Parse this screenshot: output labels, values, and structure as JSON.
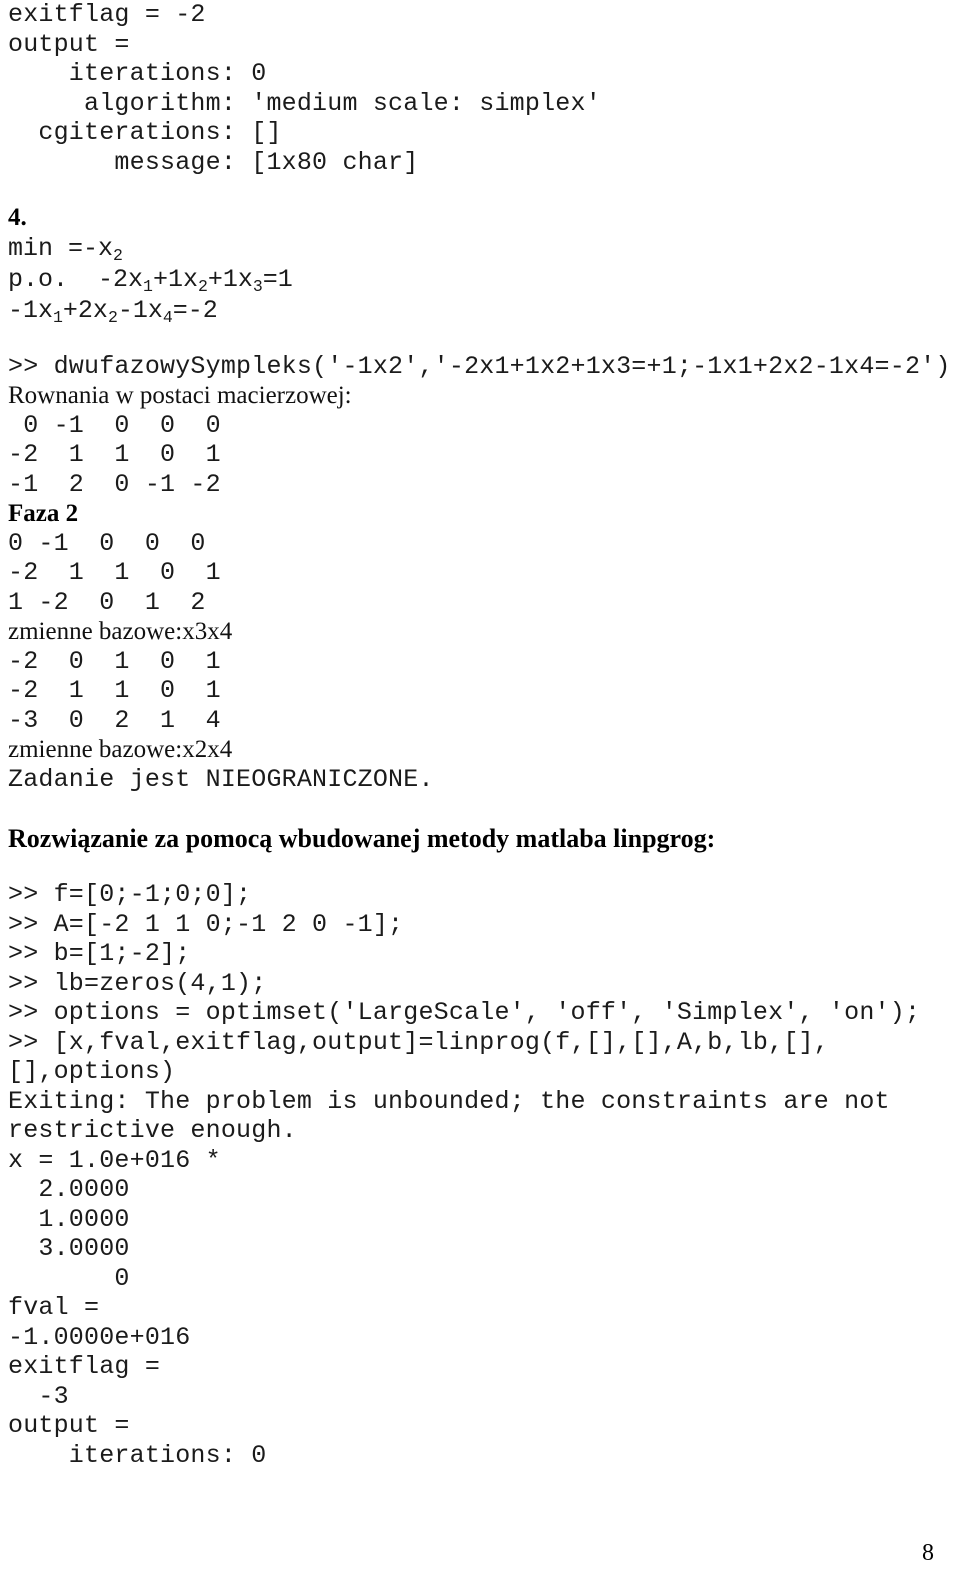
{
  "document": {
    "page_number": "8",
    "top_output_struct": {
      "exitflag_line": "exitflag = -2",
      "output_label": "output =",
      "fields": [
        "    iterations: 0",
        "     algorithm: 'medium scale: simplex'",
        "  cgiterations: []",
        "       message: [1x80 char]"
      ]
    },
    "problem": {
      "number": "4.",
      "objective_prefix": "min =-x",
      "objective_sub": "2",
      "constraint1": {
        "prefix": "p.o.  -2x",
        "s1": "1",
        "t1": "+1x",
        "s2": "2",
        "t2": "+1x",
        "s3": "3",
        "t3": "=1"
      },
      "constraint2": {
        "prefix": "-1x",
        "s1": "1",
        "t1": "+2x",
        "s2": "2",
        "t2": "-1x",
        "s3": "4",
        "t3": "=-2"
      }
    },
    "simplex_run": {
      "command": ">> dwufazowySympleks('-1x2','-2x1+1x2+1x3=+1;-1x1+2x2-1x4=-2')",
      "matrix_label": "Rownania w postaci macierzowej:",
      "matrix1": [
        " 0 -1  0  0  0",
        "-2  1  1  0  1",
        "-1  2  0 -1 -2"
      ],
      "faza2_label": "Faza 2",
      "matrix2": [
        "0 -1  0  0  0",
        "-2  1  1  0  1",
        "1 -2  0  1  2"
      ],
      "basis1_label": "zmienne bazowe:x3x4",
      "matrix3": [
        "-2  0  1  0  1",
        "-2  1  1  0  1",
        "-3  0  2  1  4"
      ],
      "basis2_label": "zmienne bazowe:x2x4",
      "result_message": "Zadanie jest NIEOGRANICZONE."
    },
    "linprog_section": {
      "heading": "Rozwiązanie za pomocą wbudowanej metody matlaba linpgrog:",
      "commands": [
        ">> f=[0;-1;0;0];",
        ">> A=[-2 1 1 0;-1 2 0 -1];",
        ">> b=[1;-2];",
        ">> lb=zeros(4,1);",
        ">> options = optimset('LargeScale', 'off', 'Simplex', 'on');",
        ">> [x,fval,exitflag,output]=linprog(f,[],[],A,b,lb,[],",
        "[],options)"
      ],
      "exit_message_line1": "Exiting: The problem is unbounded; the constraints are not",
      "exit_message_line2": "restrictive enough.",
      "x_label": "x = 1.0e+016 *",
      "x_values": [
        "  2.0000",
        "  1.0000",
        "  3.0000",
        "       0"
      ],
      "fval_label": "fval =",
      "fval_value": "-1.0000e+016",
      "exitflag_label": "exitflag =",
      "exitflag_value": "  -3",
      "output_label": "output =",
      "output_fields": [
        "    iterations: 0"
      ]
    }
  }
}
